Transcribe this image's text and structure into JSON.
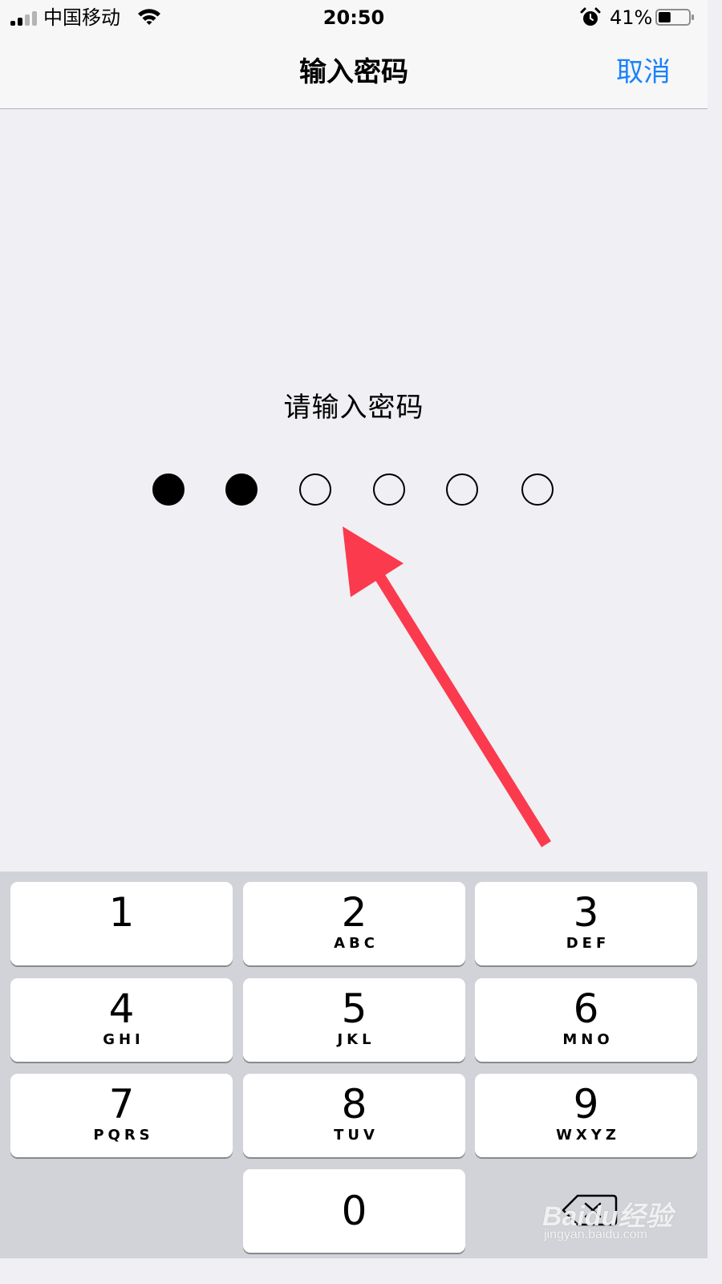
{
  "status_bar": {
    "carrier": "中国移动",
    "time": "20:50",
    "battery_percent": "41%",
    "battery_level": 0.41,
    "signal_bars_active": 2,
    "signal_bars_total": 4
  },
  "nav": {
    "title": "输入密码",
    "cancel_label": "取消"
  },
  "main": {
    "prompt": "请输入密码",
    "passcode_length": 6,
    "digits_entered": 2
  },
  "keypad": {
    "keys": [
      {
        "digit": "1",
        "letters": ""
      },
      {
        "digit": "2",
        "letters": "ABC"
      },
      {
        "digit": "3",
        "letters": "DEF"
      },
      {
        "digit": "4",
        "letters": "GHI"
      },
      {
        "digit": "5",
        "letters": "JKL"
      },
      {
        "digit": "6",
        "letters": "MNO"
      },
      {
        "digit": "7",
        "letters": "PQRS"
      },
      {
        "digit": "8",
        "letters": "TUV"
      },
      {
        "digit": "9",
        "letters": "WXYZ"
      },
      {
        "digit": "0",
        "letters": ""
      }
    ]
  },
  "annotation": {
    "arrow_color": "#fb3a4d"
  },
  "watermark": {
    "brand": "Baidu经验",
    "url": "jingyan.baidu.com"
  },
  "colors": {
    "accent": "#1a82fb",
    "background": "#efeff4",
    "keypad_background": "#d1d3d9"
  }
}
